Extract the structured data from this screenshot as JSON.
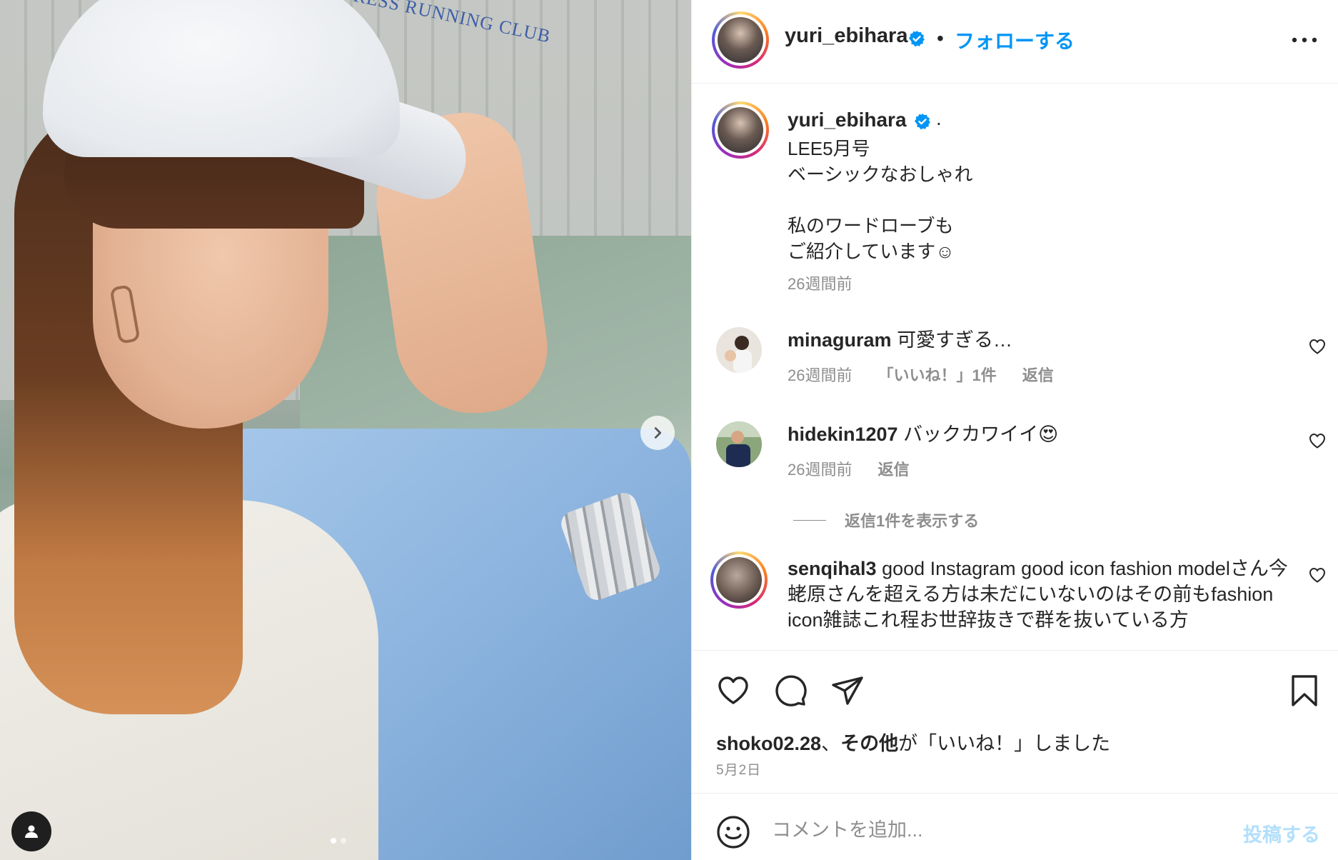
{
  "post": {
    "username": "yuri_ebihara",
    "follow_label": "フォローする",
    "separator": "•",
    "caption_dot": ".",
    "caption_lines": [
      "LEE5月号",
      "ベーシックなおしゃれ",
      "",
      "私のワードローブも",
      "ご紹介しています☺"
    ],
    "caption_time": "26週間前",
    "cap_text": "PROGRESS RUNNING CLUB"
  },
  "comments": [
    {
      "username": "minaguram",
      "text": "可愛すぎる…",
      "time": "26週間前",
      "likes_label": "「いいね！」1件",
      "reply_label": "返信"
    },
    {
      "username": "hidekin1207",
      "text": "バックカワイイ😍",
      "time": "26週間前",
      "reply_label": "返信"
    },
    {
      "username": "senqihal3",
      "text": "good Instagram good icon fashion modelさん今蛯原さんを超える方は未だにいないのはその前もfashion icon雑誌これ程お世辞抜きで群を抜いている方"
    }
  ],
  "view_replies_label": "返信1件を表示する",
  "likes": {
    "user": "shoko02.28",
    "sep": "、",
    "others": "その他",
    "suffix": "が「いいね！」しました"
  },
  "date": "5月2日",
  "add_comment": {
    "placeholder": "コメントを追加...",
    "post_label": "投稿する"
  },
  "colors": {
    "accent": "#0095f6",
    "post_disabled": "#b2dffc",
    "muted": "#8e8e8e",
    "text": "#262626"
  },
  "icons": [
    "verified-badge-icon",
    "more-options-icon",
    "heart-icon",
    "comment-icon",
    "share-icon",
    "bookmark-icon",
    "emoji-icon",
    "chevron-right-icon",
    "user-tag-icon"
  ]
}
